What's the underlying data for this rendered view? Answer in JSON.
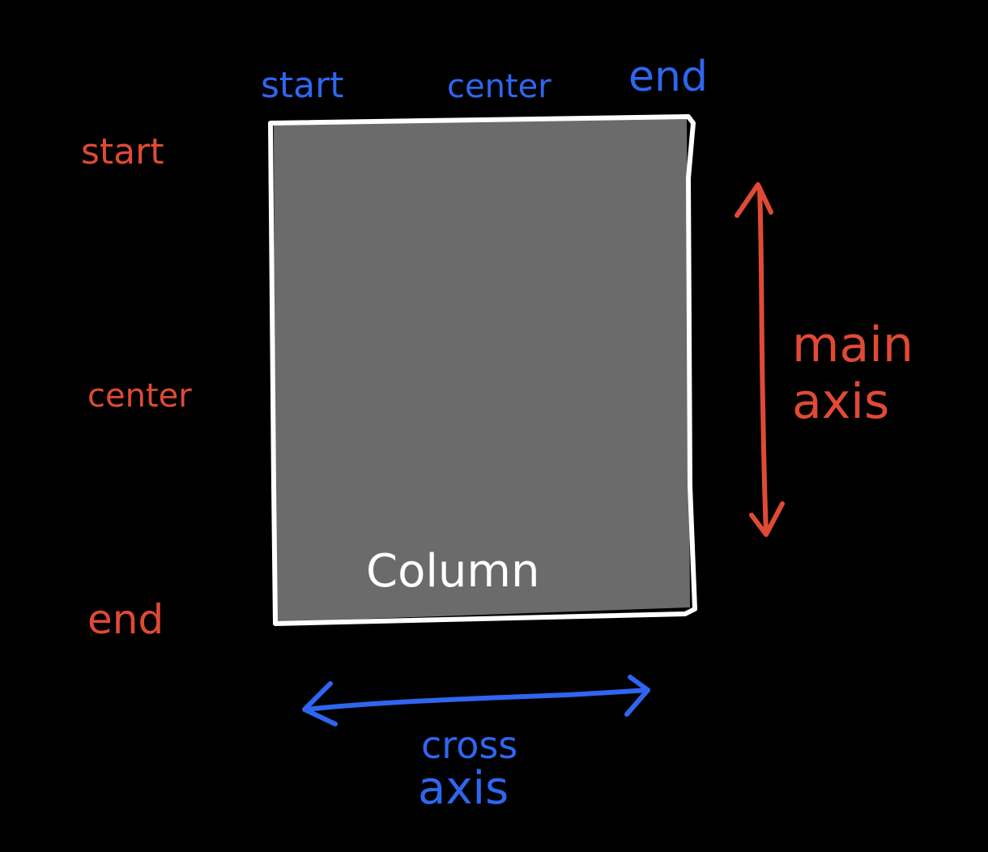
{
  "colors": {
    "background": "#000000",
    "box_fill": "#6b6b6b",
    "box_stroke": "#ffffff",
    "main_axis": "#e04a35",
    "cross_axis": "#2f66f0",
    "box_label": "#ffffff"
  },
  "box": {
    "label": "Column"
  },
  "cross_axis": {
    "labels": {
      "start": "start",
      "center": "center",
      "end": "end"
    },
    "title_line1": "cross",
    "title_line2": "axis",
    "arrow_icon": "double-headed-horizontal-arrow"
  },
  "main_axis": {
    "labels": {
      "start": "start",
      "center": "center",
      "end": "end"
    },
    "title_line1": "main",
    "title_line2": "axis",
    "arrow_icon": "double-headed-vertical-arrow"
  }
}
